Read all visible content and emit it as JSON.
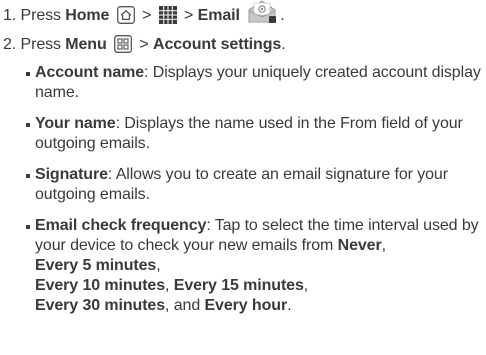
{
  "step1": {
    "number": "1.",
    "press": "Press",
    "home_label": "Home",
    "sep": ">",
    "email_label": "Email",
    "end": "."
  },
  "step2": {
    "number": "2.",
    "press": "Press",
    "menu_label": "Menu",
    "sep": ">",
    "account_settings_label": "Account settings",
    "end": "."
  },
  "bullets": [
    {
      "term": "Account name",
      "text": ": Displays your uniquely created account display name."
    },
    {
      "term": "Your name",
      "text": ": Displays the name used in the From field of your outgoing emails."
    },
    {
      "term": "Signature",
      "text": ": Allows you to create an email signature for your outgoing emails."
    }
  ],
  "freq": {
    "term": "Email check frequency",
    "text": ": Tap to select the time interval used by your device to check your new emails from",
    "opt_never": "Never",
    "comma1": ",",
    "opt_5": "Every 5 minutes",
    "comma2": ",",
    "opt_10": "Every 10 minutes",
    "comma3": ",",
    "opt_15": "Every 15 minutes",
    "comma4": ",",
    "opt_30": "Every 30 minutes",
    "and": ", and",
    "opt_hour": "Every hour",
    "end": "."
  },
  "icons": {
    "home": "home-key-icon",
    "apps": "applications-grid-icon",
    "email": "email-app-icon",
    "menu": "menu-key-icon"
  }
}
